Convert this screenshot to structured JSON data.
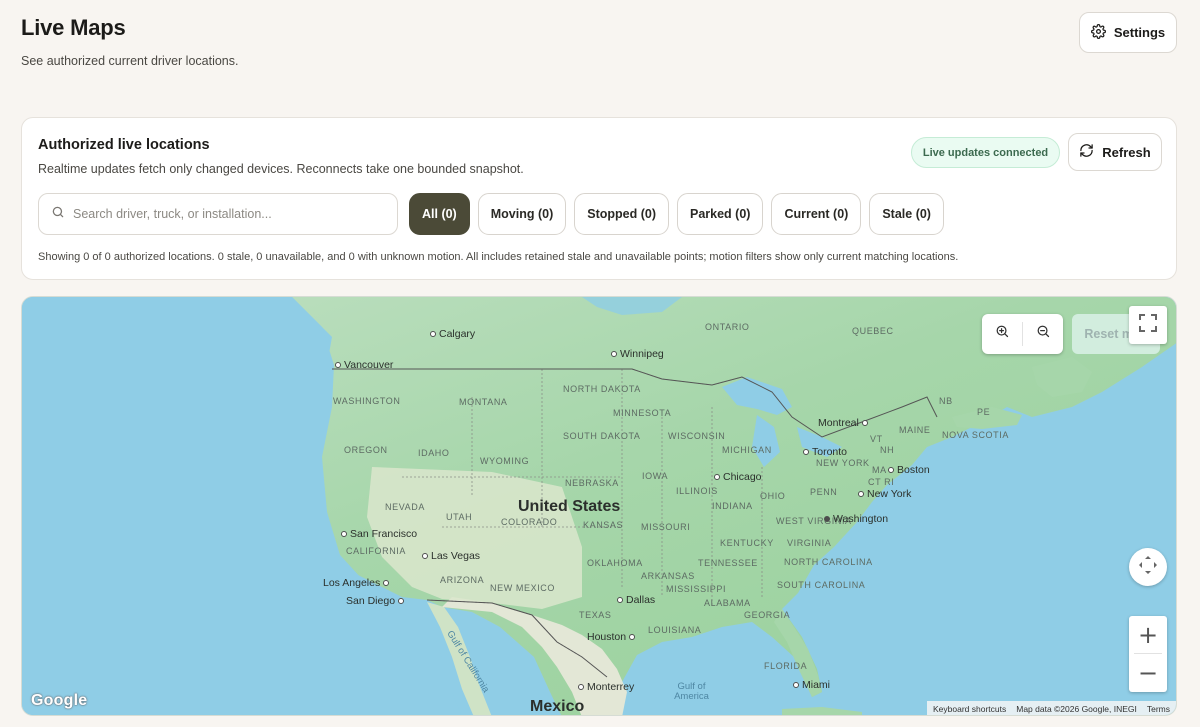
{
  "header": {
    "title": "Live Maps",
    "subtitle": "See authorized current driver locations.",
    "settings_label": "Settings"
  },
  "card": {
    "title": "Authorized live locations",
    "description": "Realtime updates fetch only changed devices. Reconnects take one bounded snapshot.",
    "live_badge": "Live updates connected",
    "refresh_label": "Refresh",
    "search_placeholder": "Search driver, truck, or installation...",
    "filters": [
      {
        "label": "All (0)",
        "active": true
      },
      {
        "label": "Moving (0)",
        "active": false
      },
      {
        "label": "Stopped (0)",
        "active": false
      },
      {
        "label": "Parked (0)",
        "active": false
      },
      {
        "label": "Current (0)",
        "active": false
      },
      {
        "label": "Stale (0)",
        "active": false
      }
    ],
    "showing_text": "Showing 0 of 0 authorized locations. 0 stale, 0 unavailable, and 0 with unknown motion. All includes retained stale and unavailable points; motion filters show only current matching locations."
  },
  "map": {
    "reset_label": "Reset map",
    "zoom_in_symbol": "+",
    "zoom_out_symbol": "−",
    "google_logo": "Google",
    "attribution": {
      "shortcuts": "Keyboard shortcuts",
      "data": "Map data ©2026 Google, INEGI",
      "terms": "Terms"
    },
    "country_labels": [
      "United States",
      "Mexico"
    ],
    "region_labels": [
      "ONTARIO",
      "QUEBEC",
      "NORTH DAKOTA",
      "MINNESOTA",
      "MONTANA",
      "WASHINGTON",
      "SOUTH DAKOTA",
      "WISCONSIN",
      "MICHIGAN",
      "OREGON",
      "IDAHO",
      "WYOMING",
      "IOWA",
      "NEBRASKA",
      "ILLINOIS",
      "OHIO",
      "PENN",
      "NEVADA",
      "UTAH",
      "COLORADO",
      "KANSAS",
      "INDIANA",
      "WEST VIRGINIA",
      "VIRGINIA",
      "MISSOURI",
      "KENTUCKY",
      "CALIFORNIA",
      "NORTH CAROLINA",
      "TENNESSEE",
      "OKLAHOMA",
      "ARKANSAS",
      "ARIZONA",
      "NEW MEXICO",
      "SOUTH CAROLINA",
      "MISSISSIPPI",
      "ALABAMA",
      "GEORGIA",
      "TEXAS",
      "LOUISIANA",
      "FLORIDA",
      "NEW YORK",
      "VT",
      "MAINE",
      "NB",
      "PE",
      "NOVA SCOTIA",
      "MA",
      "CT RI",
      "NH"
    ],
    "cities": [
      "Calgary",
      "Vancouver",
      "Winnipeg",
      "Montreal",
      "Toronto",
      "Boston",
      "Chicago",
      "New York",
      "Washington",
      "San Francisco",
      "Las Vegas",
      "Los Angeles",
      "San Diego",
      "Dallas",
      "Houston",
      "Monterrey",
      "Miami"
    ],
    "water_labels": [
      "Gulf of California",
      "Gulf of America"
    ]
  }
}
